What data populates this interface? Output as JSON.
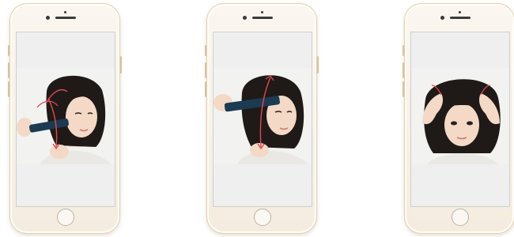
{
  "phones": [
    {
      "image_icon": "phone-screen-woman-straightening-hair-arrows-icon"
    },
    {
      "image_icon": "phone-screen-woman-flat-iron-hair-icon"
    },
    {
      "image_icon": "phone-screen-woman-fluffing-hair-hands-icon"
    }
  ],
  "colors": {
    "phone_body": "#f4ecdf",
    "phone_edge": "#e2cfae",
    "screen_bg": "#efefef",
    "hair": "#1f1a17",
    "skin": "#f3d9c6",
    "iron": "#1c3a52",
    "arrow": "#e0484f"
  }
}
